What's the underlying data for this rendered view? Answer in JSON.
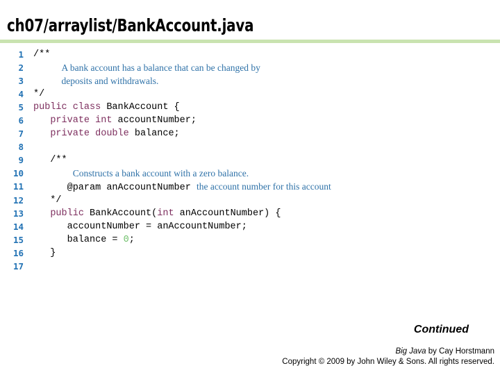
{
  "header": {
    "title": "ch07/arraylist/BankAccount.java",
    "rule_color": "#c9e3b0"
  },
  "colors": {
    "line_number": "#2272b4",
    "keyword": "#7d2e5e",
    "comment": "#2f72a8",
    "number_literal": "#6fc06a",
    "plain_code": "#000000",
    "background": "#ffffff"
  },
  "code": {
    "language": "java",
    "first_line_number": 1,
    "last_line_number": 17,
    "lines": [
      {
        "no": "1",
        "tokens": [
          {
            "t": "/**",
            "k": "plain"
          }
        ]
      },
      {
        "no": "2",
        "tokens": [
          {
            "t": "     ",
            "k": "plain"
          },
          {
            "t": "A bank account has a balance that can be changed by",
            "k": "comment"
          }
        ]
      },
      {
        "no": "3",
        "tokens": [
          {
            "t": "     ",
            "k": "plain"
          },
          {
            "t": "deposits and withdrawals.",
            "k": "comment"
          }
        ]
      },
      {
        "no": "4",
        "tokens": [
          {
            "t": "*/",
            "k": "plain"
          }
        ]
      },
      {
        "no": "5",
        "tokens": [
          {
            "t": "public class ",
            "k": "keyword"
          },
          {
            "t": "BankAccount {",
            "k": "plain"
          }
        ]
      },
      {
        "no": "6",
        "tokens": [
          {
            "t": "   ",
            "k": "plain"
          },
          {
            "t": "private int ",
            "k": "keyword"
          },
          {
            "t": "accountNumber;",
            "k": "plain"
          }
        ]
      },
      {
        "no": "7",
        "tokens": [
          {
            "t": "   ",
            "k": "plain"
          },
          {
            "t": "private double ",
            "k": "keyword"
          },
          {
            "t": "balance;",
            "k": "plain"
          }
        ]
      },
      {
        "no": "8",
        "tokens": []
      },
      {
        "no": "9",
        "tokens": [
          {
            "t": "   /**",
            "k": "plain"
          }
        ]
      },
      {
        "no": "10",
        "tokens": [
          {
            "t": "       ",
            "k": "plain"
          },
          {
            "t": "Constructs a bank account with a zero balance.",
            "k": "comment"
          }
        ]
      },
      {
        "no": "11",
        "tokens": [
          {
            "t": "      @param anAccountNumber ",
            "k": "plain"
          },
          {
            "t": "the account number for this account",
            "k": "comment"
          }
        ]
      },
      {
        "no": "12",
        "tokens": [
          {
            "t": "   */",
            "k": "plain"
          }
        ]
      },
      {
        "no": "13",
        "tokens": [
          {
            "t": "   ",
            "k": "plain"
          },
          {
            "t": "public ",
            "k": "keyword"
          },
          {
            "t": "BankAccount(",
            "k": "plain"
          },
          {
            "t": "int ",
            "k": "keyword"
          },
          {
            "t": "anAccountNumber) {",
            "k": "plain"
          }
        ]
      },
      {
        "no": "14",
        "tokens": [
          {
            "t": "      accountNumber = anAccountNumber;",
            "k": "plain"
          }
        ]
      },
      {
        "no": "15",
        "tokens": [
          {
            "t": "      balance = ",
            "k": "plain"
          },
          {
            "t": "0",
            "k": "number"
          },
          {
            "t": ";",
            "k": "plain"
          }
        ]
      },
      {
        "no": "16",
        "tokens": [
          {
            "t": "   }",
            "k": "plain"
          }
        ]
      },
      {
        "no": "17",
        "tokens": []
      }
    ]
  },
  "footer": {
    "continued_label": "Continued",
    "credit_book": "Big Java",
    "credit_rest": " by Cay Horstmann",
    "copyright": "Copyright © 2009 by John Wiley & Sons.  All rights reserved."
  }
}
